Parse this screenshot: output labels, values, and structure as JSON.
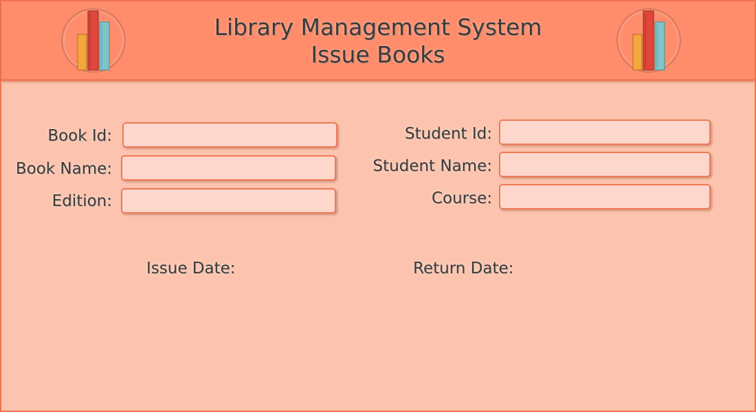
{
  "header": {
    "title_line1": "Library Management System",
    "title_line2": "Issue Books"
  },
  "logo": {
    "icon": "books-icon",
    "book_colors": [
      "#f2a83a",
      "#e0463a",
      "#7ec4c9"
    ]
  },
  "book_section": {
    "book_id_label": "Book Id:",
    "book_id_value": "",
    "book_name_label": "Book Name:",
    "book_name_value": "",
    "edition_label": "Edition:",
    "edition_value": ""
  },
  "student_section": {
    "student_id_label": "Student Id:",
    "student_id_value": "",
    "student_name_label": "Student Name:",
    "student_name_value": "",
    "course_label": "Course:",
    "course_value": ""
  },
  "dates": {
    "issue_date_label": "Issue Date:",
    "return_date_label": "Return Date:"
  },
  "colors": {
    "header_bg": "#ff8d6b",
    "body_bg": "#fcc4ae",
    "field_bg": "#fdd7cb",
    "border_accent": "#ef7a57"
  }
}
